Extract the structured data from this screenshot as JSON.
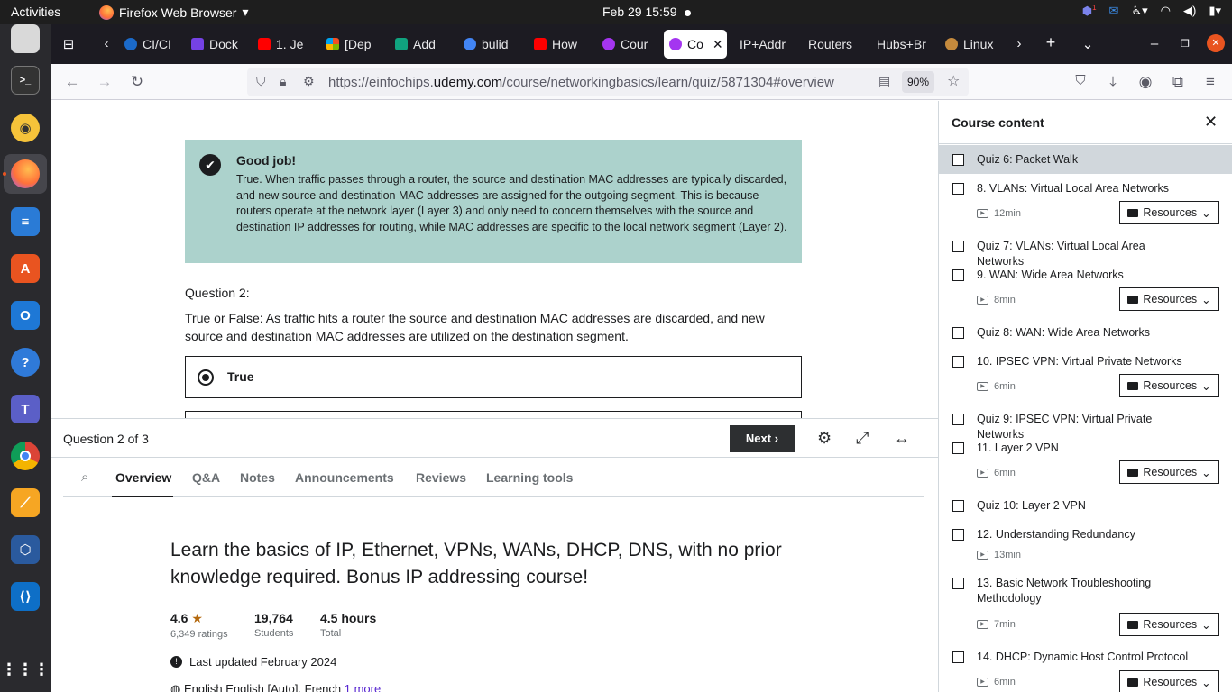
{
  "topbar": {
    "activities": "Activities",
    "app_name": "Firefox Web Browser",
    "clock": "Feb 29  15:59",
    "badge_count": "1"
  },
  "tabs": [
    {
      "label": "CI/CI",
      "color": "#1b6ac9"
    },
    {
      "label": "Dock",
      "color": "#7542e5"
    },
    {
      "label": "1. Je",
      "color": "#ff0000"
    },
    {
      "label": "[Dep",
      "color": "#f25022"
    },
    {
      "label": "Add",
      "color": "#10a37f"
    },
    {
      "label": "bulid",
      "color": "#4285f4"
    },
    {
      "label": "How",
      "color": "#ff0000"
    },
    {
      "label": "Cour",
      "color": "#a435f0"
    },
    {
      "label": "Co",
      "color": "#a435f0"
    },
    {
      "label": "IP+Addr",
      "color": ""
    },
    {
      "label": "Routers",
      "color": ""
    },
    {
      "label": "Hubs+Br",
      "color": ""
    },
    {
      "label": "Linux",
      "color": "#c58a3d"
    }
  ],
  "navbar": {
    "url_prefix": "https://einfochips.",
    "url_domain": "udemy.com",
    "url_path": "/course/networkingbasics/learn/quiz/5871304#overview",
    "zoom": "90%"
  },
  "feedback": {
    "title": "Good job!",
    "body": "True. When traffic passes through a router, the source and destination MAC addresses are typically discarded, and new source and destination MAC addresses are assigned for the outgoing segment. This is because routers operate at the network layer (Layer 3) and only need to concern themselves with the source and destination IP addresses for routing, while MAC addresses are specific to the local network segment (Layer 2)."
  },
  "question": {
    "number": "Question 2:",
    "text": "True or False: As traffic hits a router the source and destination MAC addresses are discarded, and new source and destination MAC addresses are utilized on the destination segment.",
    "option_true": "True"
  },
  "quizbar": {
    "counter": "Question 2 of 3",
    "next": "Next"
  },
  "course_tabs": [
    "Overview",
    "Q&A",
    "Notes",
    "Announcements",
    "Reviews",
    "Learning tools"
  ],
  "course": {
    "title": "Learn the basics of IP, Ethernet, VPNs, WANs, DHCP, DNS, with no prior knowledge required. Bonus IP addressing course!",
    "rating": "4.6",
    "ratings_count": "6,349 ratings",
    "students": "19,764",
    "students_label": "Students",
    "hours": "4.5 hours",
    "hours_label": "Total",
    "updated": "Last updated February 2024",
    "langs": "English    English [Auto], French",
    "more": "1 more"
  },
  "sidebar": {
    "title": "Course content",
    "items": [
      {
        "name": "Quiz 6: Packet Walk"
      },
      {
        "name": "8. VLANs: Virtual Local Area Networks",
        "duration": "12min",
        "resources": "Resources"
      },
      {
        "name": "Quiz 7: VLANs: Virtual Local Area Networks"
      },
      {
        "name": "9. WAN: Wide Area Networks",
        "duration": "8min",
        "resources": "Resources"
      },
      {
        "name": "Quiz 8: WAN: Wide Area Networks"
      },
      {
        "name": "10. IPSEC VPN: Virtual Private Networks",
        "duration": "6min",
        "resources": "Resources"
      },
      {
        "name": "Quiz 9: IPSEC VPN: Virtual Private Networks"
      },
      {
        "name": "11. Layer 2 VPN",
        "duration": "6min",
        "resources": "Resources"
      },
      {
        "name": "Quiz 10: Layer 2 VPN"
      },
      {
        "name": "12. Understanding Redundancy",
        "duration": "13min"
      },
      {
        "name": "13. Basic Network Troubleshooting Methodology",
        "duration": "7min",
        "resources": "Resources"
      },
      {
        "name": "14. DHCP: Dynamic Host Control Protocol",
        "duration": "6min",
        "resources": "Resources"
      }
    ]
  }
}
